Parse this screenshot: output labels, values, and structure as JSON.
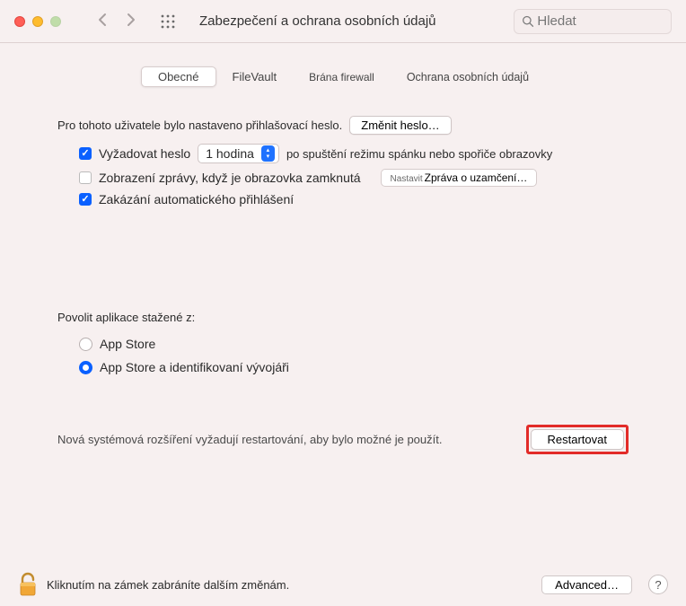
{
  "header": {
    "title": "Zabezpečení a ochrana osobních údajů",
    "search_placeholder": "Hledat"
  },
  "tabs": {
    "general": "Obecné",
    "filevault": "FileVault",
    "firewall": "Brána firewall",
    "privacy": "Ochrana osobních údajů"
  },
  "password": {
    "label": "Pro tohoto uživatele bylo nastaveno přihlašovací heslo.",
    "change_button": "Změnit heslo…"
  },
  "options": {
    "require_password_label": "Vyžadovat heslo",
    "require_password_delay": "1 hodina",
    "require_password_after": "po spuštění režimu spánku nebo spořiče obrazovky",
    "show_message_label": "Zobrazení zprávy, když je obrazovka zamknutá",
    "set_lock_prefix": "Nastavit",
    "set_lock_message_button": "Zpráva o uzamčení…",
    "disable_autologin_label": "Zakázání automatického přihlášení"
  },
  "allow_apps": {
    "label": "Povolit aplikace stažené z:",
    "app_store": "App Store",
    "app_store_dev": "App Store a identifikovaní vývojáři"
  },
  "restart": {
    "message": "Nová systémová rozšíření vyžadují restartování, aby bylo možné je použít.",
    "button": "Restartovat"
  },
  "footer": {
    "lock_text": "Kliknutím na zámek zabráníte dalším změnám.",
    "advanced_button": "Advanced…",
    "help": "?"
  }
}
